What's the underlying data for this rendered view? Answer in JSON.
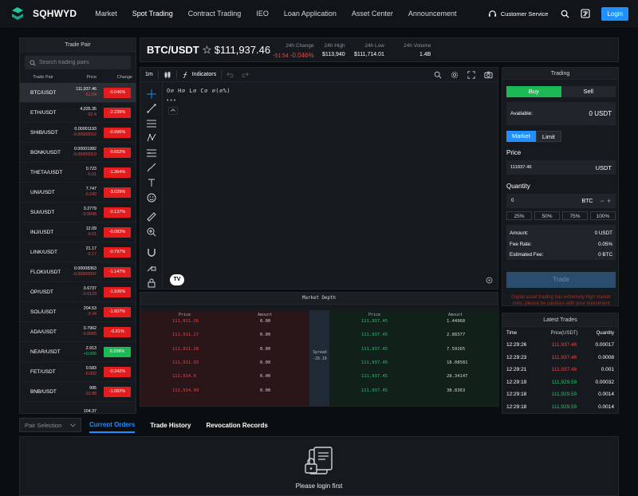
{
  "brand": {
    "name": "SQHWYD"
  },
  "nav": {
    "menu": [
      "Market",
      "Spot Trading",
      "Contract Trading",
      "IEO",
      "Loan Application",
      "Asset Center",
      "Announcement"
    ],
    "customer_service": "Customer Service",
    "login": "Login"
  },
  "pairs_panel": {
    "title": "Trade Pair",
    "search_placeholder": "Search trading pairs",
    "columns": [
      "Trade Pair",
      "Price",
      "Change"
    ],
    "rows": [
      {
        "name": "BTC/USDT",
        "price": "111,937.46",
        "change_abs": "-51.54",
        "change_pct": "-0.046%",
        "up": false
      },
      {
        "name": "ETH/USDT",
        "price": "4,035.35",
        "change_abs": "-92.4",
        "change_pct": "-2.239%",
        "up": false
      },
      {
        "name": "SHIB/USDT",
        "price": "0.00001193",
        "change_abs": "-0.00000012",
        "change_pct": "-0.996%",
        "up": false
      },
      {
        "name": "BONK/USDT",
        "price": "0.00001982",
        "change_abs": "-0.00000013",
        "change_pct": "-0.652%",
        "up": false
      },
      {
        "name": "THETA/USDT",
        "price": "0.723",
        "change_abs": "-0.01",
        "change_pct": "-1.364%",
        "up": false
      },
      {
        "name": "UNI/USDT",
        "price": "7.747",
        "change_abs": "-0.242",
        "change_pct": "-3.029%",
        "up": false
      },
      {
        "name": "SUI/USDT",
        "price": "3.2779",
        "change_abs": "-0.0045",
        "change_pct": "-0.137%",
        "up": false
      },
      {
        "name": "INJ/USDT",
        "price": "12.09",
        "change_abs": "-0.01",
        "change_pct": "-0.083%",
        "up": false
      },
      {
        "name": "LINK/USDT",
        "price": "21.17",
        "change_abs": "-0.17",
        "change_pct": "-0.797%",
        "up": false
      },
      {
        "name": "FLOKI/USDT",
        "price": "0.00008363",
        "change_abs": "-0.00000097",
        "change_pct": "-1.147%",
        "up": false
      },
      {
        "name": "OP/USDT",
        "price": "0.6737",
        "change_abs": "-0.0133",
        "change_pct": "-1.936%",
        "up": false
      },
      {
        "name": "SOL/USDT",
        "price": "204.53",
        "change_abs": "-3.34",
        "change_pct": "-1.607%",
        "up": false
      },
      {
        "name": "ADA/USDT",
        "price": "0.7962",
        "change_abs": "-0.0065",
        "change_pct": "-0.81%",
        "up": false
      },
      {
        "name": "NEAR/USDT",
        "price": "2.913",
        "change_abs": "+0.006",
        "change_pct": "0.206%",
        "up": true
      },
      {
        "name": "FET/USDT",
        "price": "0.583",
        "change_abs": "-0.002",
        "change_pct": "-0.342%",
        "up": false
      },
      {
        "name": "BNB/USDT",
        "price": "995",
        "change_abs": "-10.88",
        "change_pct": "-1.082%",
        "up": false
      },
      {
        "name": "",
        "price": "104.37",
        "change_abs": "",
        "change_pct": "",
        "up": false
      }
    ]
  },
  "ticker": {
    "pair": "BTC/USDT",
    "price": "$111,937.46",
    "change_label": "24h Change",
    "change_abs": "-51.54",
    "change_pct": "-0.046%",
    "high_label": "24h High",
    "high": "$113,940",
    "low_label": "24h Low",
    "low": "$111,714.01",
    "volume_label": "24h Volume",
    "volume": "1.4B"
  },
  "chart": {
    "interval": "1m",
    "indicators_label": "Indicators",
    "ohlc_text": "O∅ H∅ L∅ C∅ ∅(∅%)",
    "legend_dots": "• • •",
    "tv_logo": "TV"
  },
  "depth": {
    "title": "Market Depth",
    "columns": [
      "Price",
      "Amount",
      "Price",
      "Amount"
    ],
    "spread_label": "Spread",
    "spread_value": "-26.19",
    "rows": [
      {
        "bid_price": "111,911.26",
        "bid_amount": "0.00",
        "ask_price": "111,937.45",
        "ask_amount": "1.44968"
      },
      {
        "bid_price": "111,911.27",
        "bid_amount": "0.00",
        "ask_price": "111,937.45",
        "ask_amount": "2.88377"
      },
      {
        "bid_price": "111,911.28",
        "bid_amount": "0.00",
        "ask_price": "111,937.45",
        "ask_amount": "7.59165"
      },
      {
        "bid_price": "111,911.93",
        "bid_amount": "0.00",
        "ask_price": "111,937.45",
        "ask_amount": "18.08581"
      },
      {
        "bid_price": "111,914.9",
        "bid_amount": "0.00",
        "ask_price": "111,937.45",
        "ask_amount": "28.34147"
      },
      {
        "bid_price": "111,914.99",
        "bid_amount": "0.00",
        "ask_price": "111,937.45",
        "ask_amount": "38.8363"
      }
    ]
  },
  "trading": {
    "title": "Trading",
    "buy": "Buy",
    "sell": "Sell",
    "available_label": "Available:",
    "available_value": "0 USDT",
    "market": "Market",
    "limit": "Limit",
    "price_label": "Price",
    "price_value": "111937.46",
    "price_unit": "USDT",
    "qty_label": "Quantity",
    "qty_value": "0",
    "qty_unit": "BTC",
    "minus": "−",
    "plus": "+",
    "percents": [
      "25%",
      "50%",
      "75%",
      "100%"
    ],
    "info": [
      {
        "label": "Amount:",
        "value": "0 USDT"
      },
      {
        "label": "Fee Rate:",
        "value": "0.05%"
      },
      {
        "label": "Estimated Fee:",
        "value": "0 BTC"
      }
    ],
    "trade_button": "Trade",
    "warning": "Digital asset trading has extremely high market risks, please be cautious with your investment"
  },
  "latest_trades": {
    "title": "Latest Trades",
    "columns": [
      "Time",
      "Price(USDT)",
      "Quantity"
    ],
    "rows": [
      {
        "time": "12:29:26",
        "price": "111,937.46",
        "qty": "0.00017",
        "side": "red"
      },
      {
        "time": "12:29:23",
        "price": "111,937.46",
        "qty": "0.0008",
        "side": "red"
      },
      {
        "time": "12:29:21",
        "price": "111,937.46",
        "qty": "0.001",
        "side": "red"
      },
      {
        "time": "12:29:19",
        "price": "111,929.59",
        "qty": "0.00032",
        "side": "green"
      },
      {
        "time": "12:29:18",
        "price": "111,929.59",
        "qty": "0.0014",
        "side": "green"
      },
      {
        "time": "12:29:18",
        "price": "111,929.59",
        "qty": "0.0014",
        "side": "green"
      }
    ]
  },
  "orders": {
    "pair_selection": "Pair Selection",
    "tabs": [
      "Current Orders",
      "Trade History",
      "Revocation Records"
    ],
    "empty_text": "Please login first"
  },
  "colors": {
    "up": "#1db954",
    "down": "#e31d1d",
    "accent": "#1e90ff"
  }
}
